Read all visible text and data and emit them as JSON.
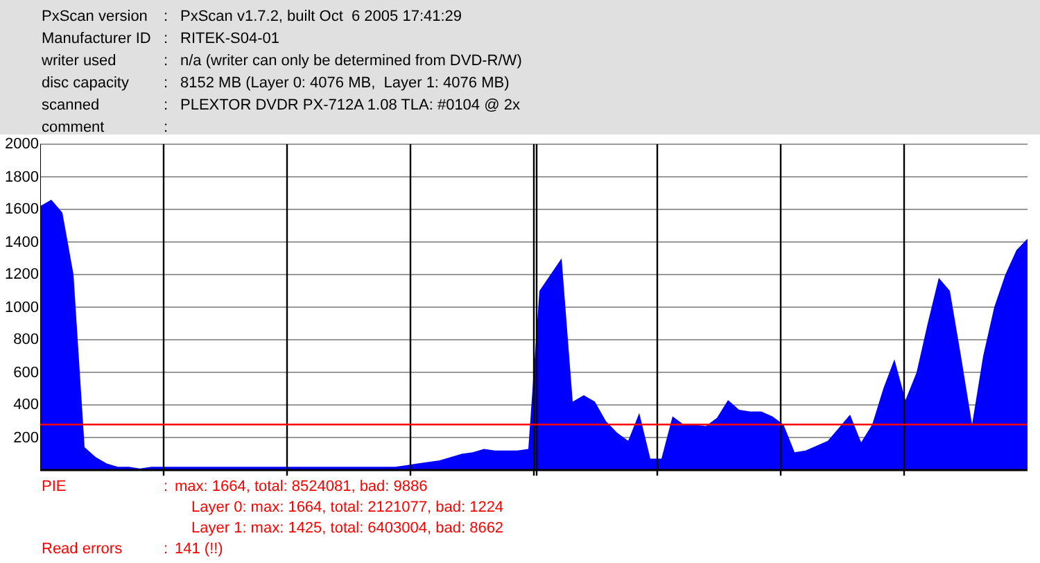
{
  "info": [
    {
      "label": "PxScan version",
      "sep": ":",
      "value": "PxScan v1.7.2, built Oct  6 2005 17:41:29"
    },
    {
      "label": "Manufacturer ID",
      "sep": ":",
      "value": "RITEK-S04-01"
    },
    {
      "label": "writer used",
      "sep": ":",
      "value": "n/a (writer can only be determined from DVD-R/W)"
    },
    {
      "label": "disc capacity",
      "sep": ":",
      "value": "8152 MB (Layer 0: 4076 MB,  Layer 1: 4076 MB)"
    },
    {
      "label": "scanned",
      "sep": ":",
      "value": "PLEXTOR DVDR PX-712A 1.08 TLA: #0104 @ 2x"
    },
    {
      "label": "comment",
      "sep": ":"
    }
  ],
  "chart": {
    "chart_data": {
      "type": "area",
      "grid": true,
      "ylim": [
        0,
        2000
      ],
      "yticks": [
        200,
        400,
        600,
        800,
        1000,
        1200,
        1400,
        1600,
        1800,
        2000
      ],
      "series": [
        {
          "color": "#0000ff",
          "values": [
            1620,
            1660,
            1580,
            1200,
            140,
            80,
            40,
            20,
            20,
            10,
            20,
            20,
            20,
            20,
            20,
            20,
            20,
            20,
            20,
            20,
            20,
            20,
            20,
            20,
            20,
            20,
            20,
            20,
            20,
            20,
            20,
            20,
            20,
            30,
            40,
            50,
            60,
            80,
            100,
            110,
            130,
            120,
            120,
            120,
            130,
            1100,
            1200,
            1300,
            420,
            460,
            420,
            300,
            230,
            180,
            350,
            70,
            70,
            330,
            280,
            280,
            270,
            320,
            430,
            370,
            360,
            360,
            330,
            280,
            110,
            120,
            150,
            180,
            260,
            340,
            170,
            280,
            500,
            680,
            430,
            600,
            900,
            1180,
            1100,
            700,
            280,
            700,
            1000,
            1200,
            1350,
            1420
          ]
        },
        {
          "type": "line",
          "color": "#ff0000",
          "values": [
            280,
            280,
            280,
            280,
            280,
            280,
            280,
            280,
            280,
            280,
            280,
            280,
            280,
            280,
            280,
            280,
            280,
            280,
            280,
            280,
            280,
            280,
            280,
            280,
            280,
            280,
            280,
            280,
            280,
            280,
            280,
            280,
            280,
            280,
            280,
            280,
            280,
            280,
            280,
            280,
            280,
            280,
            280,
            280,
            280,
            280,
            280,
            280,
            280,
            280,
            280,
            280,
            280,
            280,
            280,
            280,
            280,
            280,
            280,
            280,
            280,
            280,
            280,
            280,
            280,
            280,
            280,
            280,
            280,
            280,
            280,
            280,
            280,
            280,
            280,
            280,
            280,
            280,
            280,
            280,
            280,
            280,
            280,
            280,
            280,
            280,
            280,
            280,
            280,
            280
          ]
        }
      ]
    }
  },
  "results": [
    {
      "kind": "main",
      "label": "PIE",
      "sep": ":",
      "value": "max: 1664, total: 8524081, bad: 9886"
    },
    {
      "kind": "sub",
      "value": "Layer 0: max: 1664, total: 2121077, bad: 1224"
    },
    {
      "kind": "sub",
      "value": "Layer 1: max: 1425, total: 6403004, bad: 8662"
    },
    {
      "kind": "main",
      "label": "Read errors",
      "sep": ":",
      "value": "141 (!!)"
    }
  ]
}
